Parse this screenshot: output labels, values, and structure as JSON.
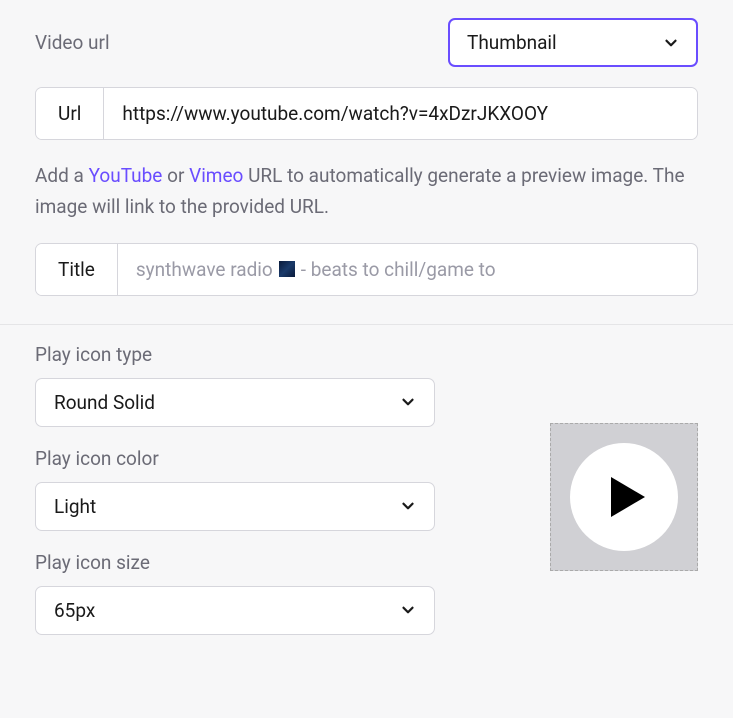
{
  "video_url": {
    "label": "Video url",
    "thumbnail_select": "Thumbnail",
    "url_prefix": "Url",
    "url_value": "https://www.youtube.com/watch?v=4xDzrJKXOOY",
    "help_pre": "Add a ",
    "help_youtube": "YouTube",
    "help_or": " or ",
    "help_vimeo": "Vimeo",
    "help_post": " URL to automatically generate a preview image. The image will link to the provided URL.",
    "title_prefix": "Title",
    "title_value_pre": "synthwave radio ",
    "title_value_post": " - beats to chill/game to"
  },
  "play_icon": {
    "type_label": "Play icon type",
    "type_value": "Round Solid",
    "color_label": "Play icon color",
    "color_value": "Light",
    "size_label": "Play icon size",
    "size_value": "65px"
  }
}
